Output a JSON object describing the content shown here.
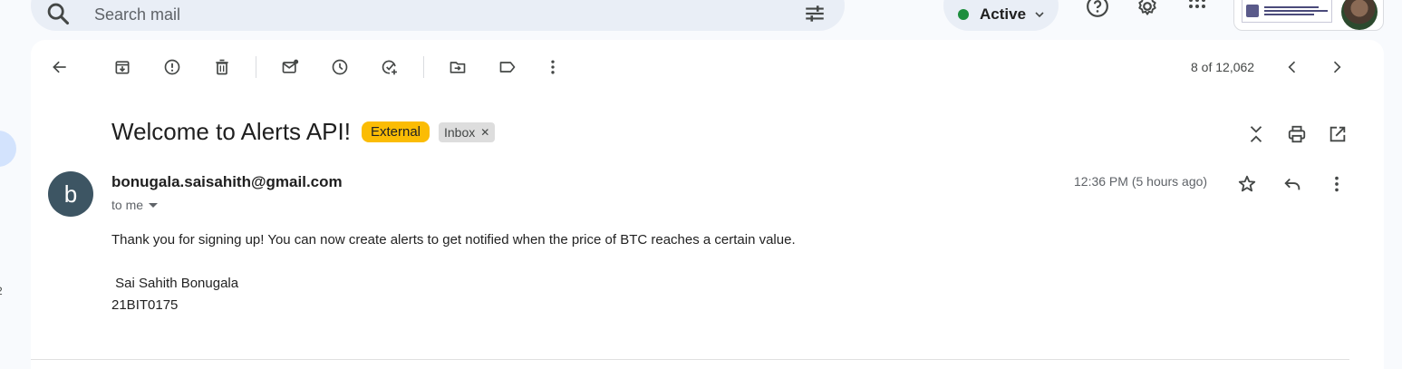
{
  "search": {
    "placeholder": "Search mail"
  },
  "status": {
    "label": "Active",
    "color": "#1e8e3e"
  },
  "header_icons": [
    "help-icon",
    "settings-icon",
    "apps-icon"
  ],
  "rail": {
    "count_fragment": "2"
  },
  "toolbar": {
    "actions": [
      "back-icon",
      "archive-icon",
      "report-spam-icon",
      "delete-icon",
      "mark-unread-icon",
      "snooze-icon",
      "add-to-tasks-icon",
      "move-to-icon",
      "label-icon",
      "more-vert-icon"
    ],
    "pager_text": "8 of 12,062"
  },
  "email": {
    "subject": "Welcome to Alerts API!",
    "labels": [
      {
        "text": "External",
        "color": "#fbbc04"
      },
      {
        "text": "Inbox",
        "color": "#dddddd"
      }
    ],
    "sender_initial": "b",
    "sender": "bonugala.saisahith@gmail.com",
    "to": "to me",
    "time": "12:36 PM (5 hours ago)",
    "body": [
      "Thank you for signing up! You can now create alerts to get notified when the price of BTC reaches a certain value.",
      "",
      " Sai Sahith Bonugala",
      "21BIT0175"
    ]
  }
}
